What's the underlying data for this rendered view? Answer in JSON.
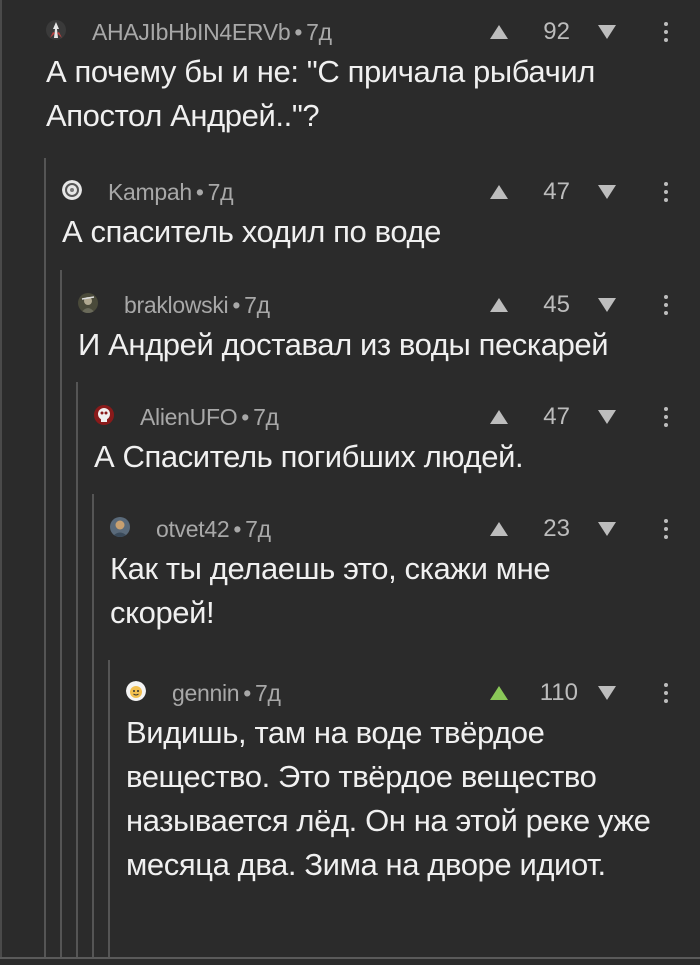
{
  "comments": [
    {
      "author": "AHAJIbHbIN4ERVb",
      "age": "7д",
      "rating": "92",
      "upvoted": false,
      "avatar_icon": "figure-icon",
      "text": "А почему бы и не: \"С причала рыбачил Апостол Андрей..\"?"
    },
    {
      "author": "Kampah",
      "age": "7д",
      "rating": "47",
      "upvoted": false,
      "avatar_icon": "globe-icon",
      "text": "А спаситель ходил по воде"
    },
    {
      "author": "braklowski",
      "age": "7д",
      "rating": "45",
      "upvoted": false,
      "avatar_icon": "soldier-icon",
      "text": "И Андрей доставал из воды пескарей"
    },
    {
      "author": "AlienUFO",
      "age": "7д",
      "rating": "47",
      "upvoted": false,
      "avatar_icon": "skull-icon",
      "text": "А Спаситель погибших людей."
    },
    {
      "author": "otvet42",
      "age": "7д",
      "rating": "23",
      "upvoted": false,
      "avatar_icon": "portrait-icon",
      "text": "Как ты делаешь это, скажи мне скорей!"
    },
    {
      "author": "gennin",
      "age": "7д",
      "rating": "110",
      "upvoted": true,
      "avatar_icon": "face-icon",
      "text": "Видишь, там на воде твёрдое вещество. Это твёрдое вещество называется лёд. Он на этой реке уже месяца два. Зима на дворе идиот."
    }
  ],
  "colors": {
    "background": "#2b2b2b",
    "text": "#f0f0f0",
    "meta": "#a8a8a8",
    "upvote_active": "#8ac858",
    "thread_line": "#555555"
  }
}
